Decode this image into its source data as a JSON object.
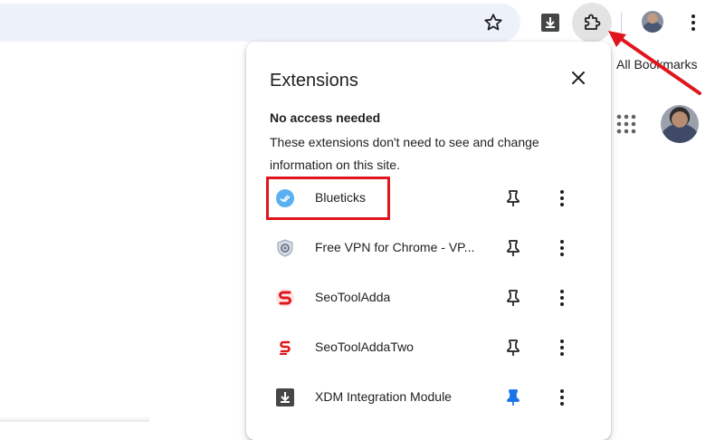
{
  "toolbar": {
    "star_icon": "star-outline-icon",
    "download_icon": "download-icon",
    "extensions_icon": "puzzle-icon",
    "menu_icon": "more-vertical-icon",
    "accent_color": "#e3e3e3"
  },
  "bookmarks_bar": {
    "all_bookmarks_label": "All Bookmarks"
  },
  "page": {
    "apps_icon": "apps-grid-icon"
  },
  "extensions_panel": {
    "title": "Extensions",
    "close_icon": "close-icon",
    "section_heading": "No access needed",
    "section_description": "These extensions don't need to see and change information on this site.",
    "items": [
      {
        "name": "Blueticks",
        "icon": "blueticks-icon",
        "pinned": false,
        "highlighted": true
      },
      {
        "name": "Free VPN for Chrome - VP...",
        "icon": "shield-vpn-icon",
        "pinned": false
      },
      {
        "name": "SeoToolAdda",
        "icon": "seotooladda-icon",
        "pinned": false
      },
      {
        "name": "SeoToolAddaTwo",
        "icon": "seotooladda-two-icon",
        "pinned": false
      },
      {
        "name": "XDM Integration Module",
        "icon": "xdm-download-icon",
        "pinned": true
      }
    ],
    "pinned_color": "#1a73e8"
  },
  "annotations": {
    "highlight_color": "#e0161c"
  }
}
